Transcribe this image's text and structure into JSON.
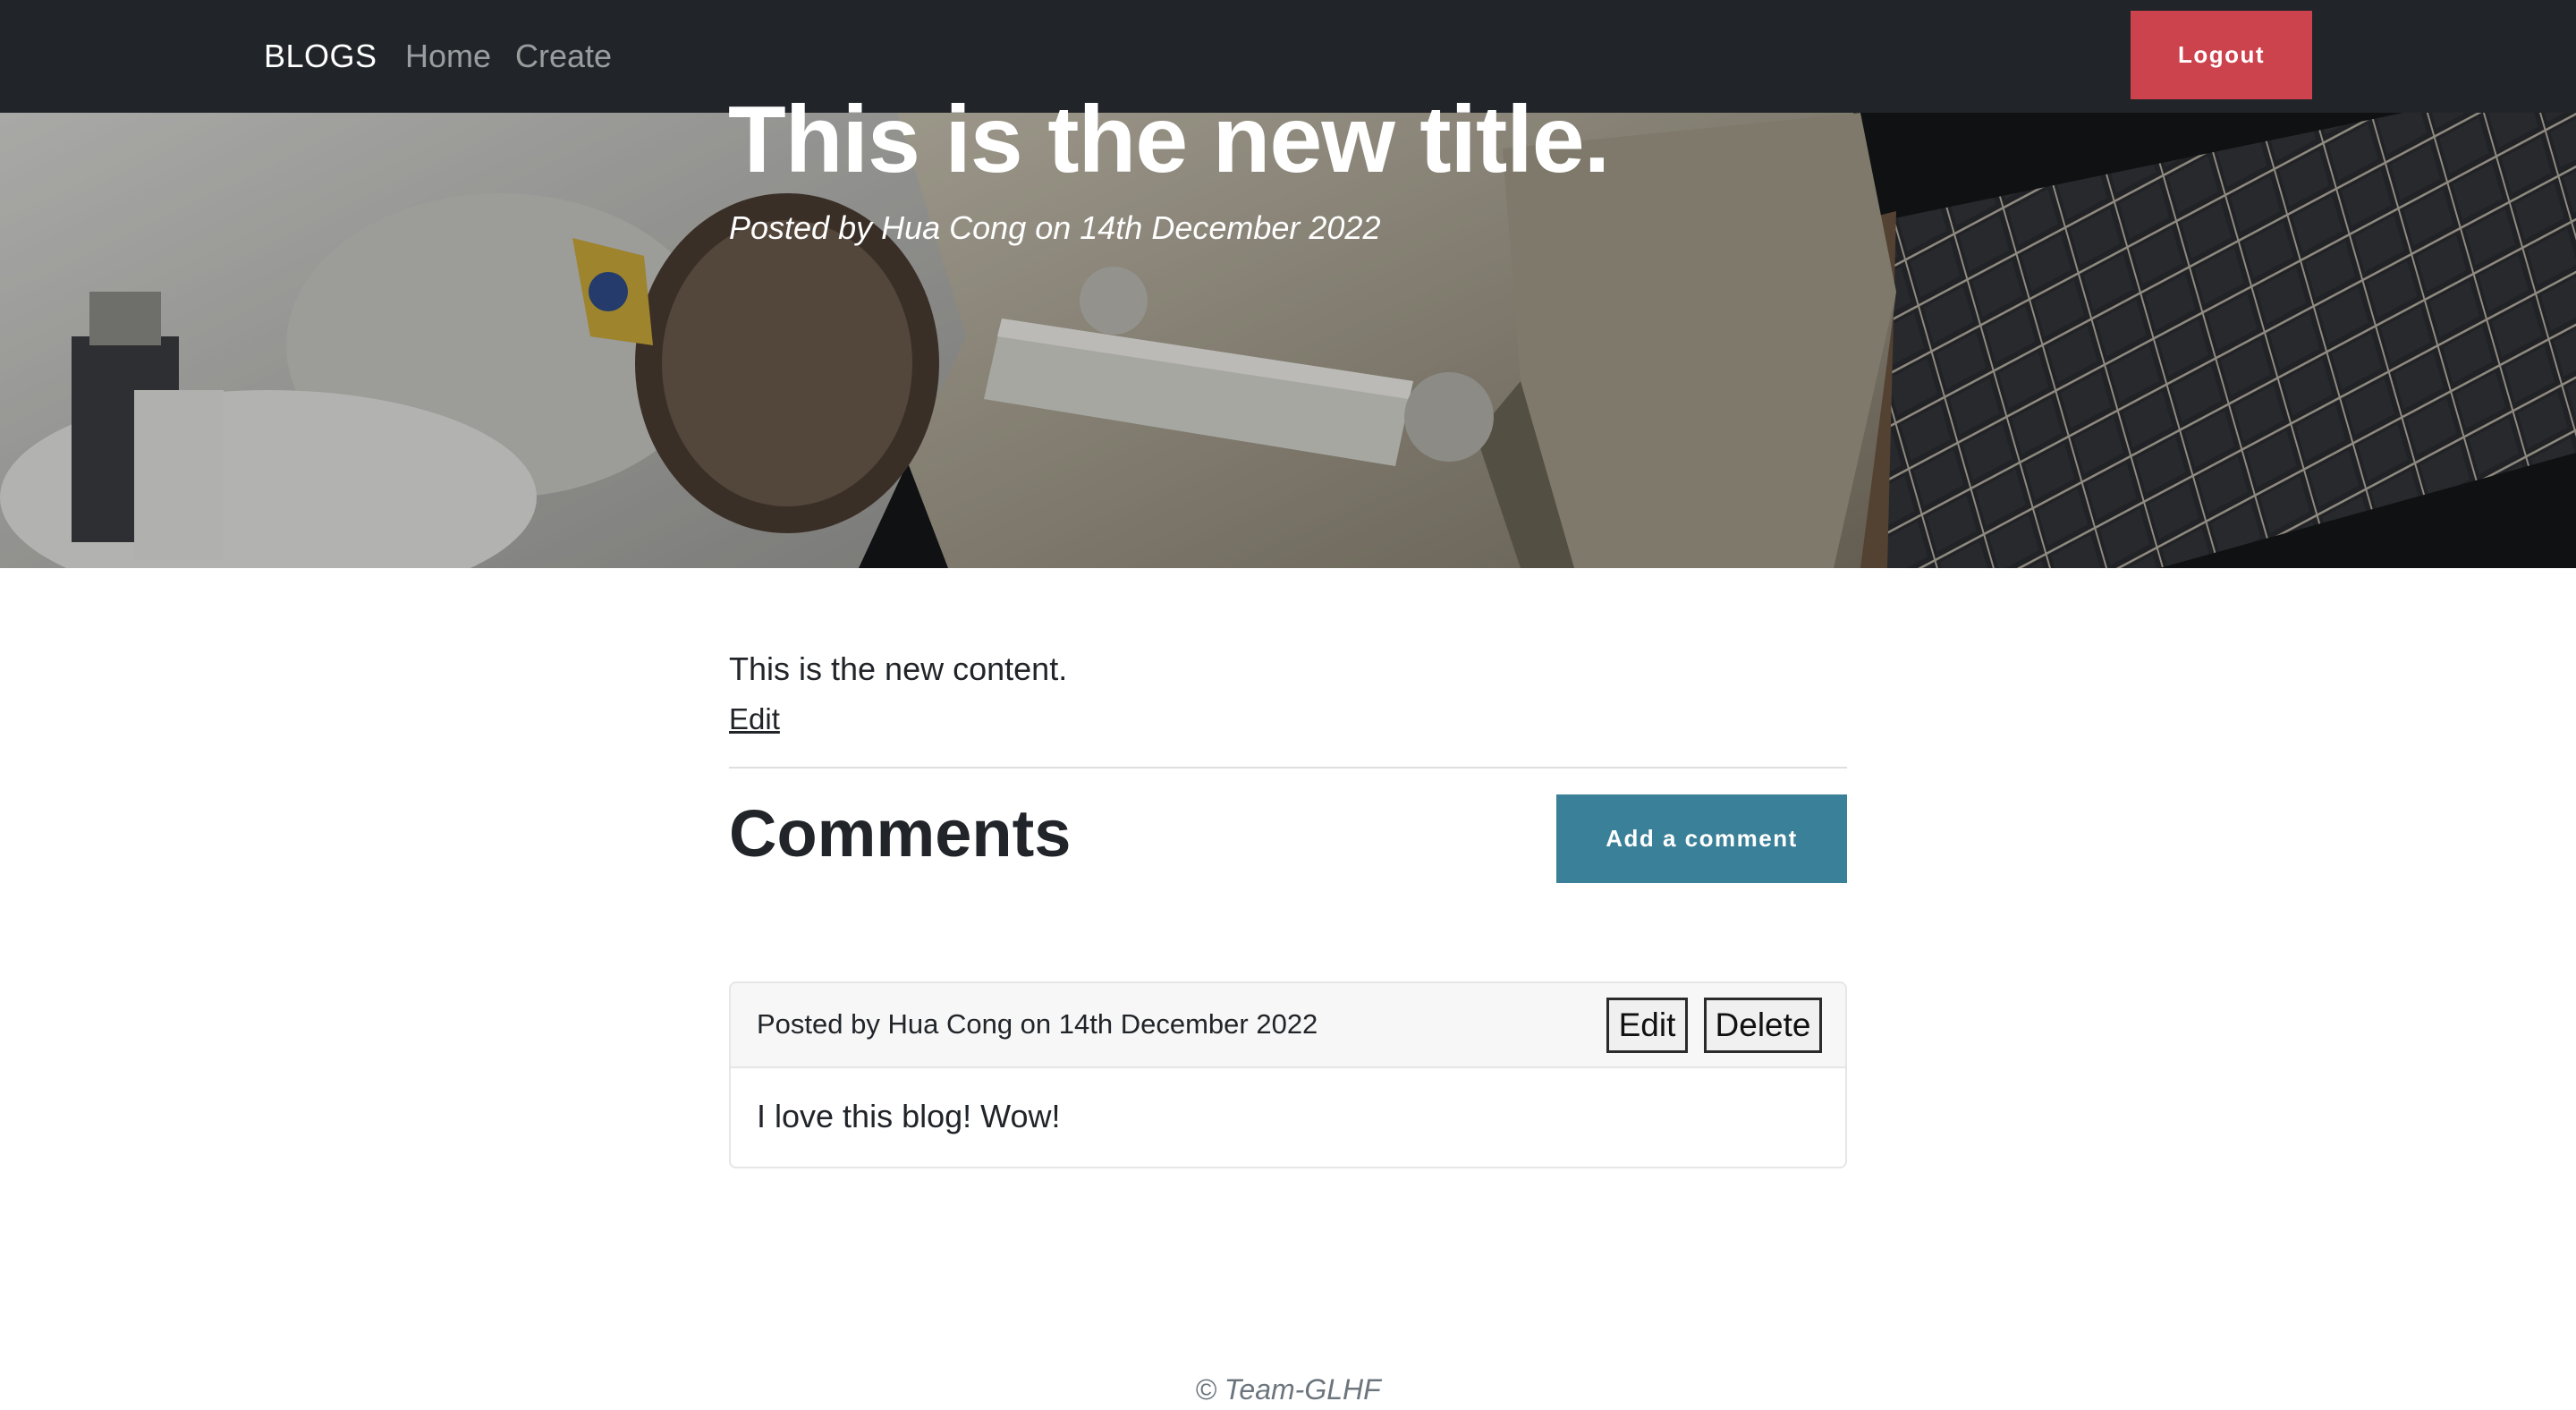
{
  "navbar": {
    "brand": "BLOGS",
    "links": [
      {
        "label": "Home"
      },
      {
        "label": "Create"
      }
    ],
    "logout_label": "Logout"
  },
  "post": {
    "title": "This is the new title.",
    "meta": "Posted by Hua Cong on 14th December 2022",
    "content": "This is the new content.",
    "edit_label": "Edit"
  },
  "comments_section": {
    "heading": "Comments",
    "add_button_label": "Add a comment",
    "items": [
      {
        "meta": "Posted by Hua Cong on 14th December 2022",
        "edit_label": "Edit",
        "delete_label": "Delete",
        "body": "I love this blog! Wow!"
      }
    ]
  },
  "footer": {
    "text": "© Team-GLHF"
  },
  "colors": {
    "navbar_bg": "#212529",
    "logout_button": "#cc434d",
    "add_comment_button": "#3a8098"
  }
}
